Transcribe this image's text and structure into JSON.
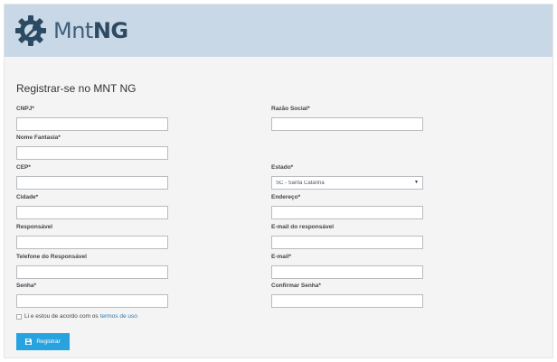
{
  "header": {
    "logo_text_light": "Mnt",
    "logo_text_bold": "NG"
  },
  "form": {
    "title": "Registrar-se no MNT NG",
    "cnpj": {
      "label": "CNPJ*",
      "value": ""
    },
    "razao_social": {
      "label": "Razão Social*",
      "value": ""
    },
    "nome_fantasia": {
      "label": "Nome Fantasia*",
      "value": ""
    },
    "cep": {
      "label": "CEP*",
      "value": ""
    },
    "estado": {
      "label": "Estado*",
      "selected": "SC - Santa Catarina"
    },
    "cidade": {
      "label": "Cidade*",
      "value": ""
    },
    "endereco": {
      "label": "Endereço*",
      "value": ""
    },
    "responsavel": {
      "label": "Responsável",
      "value": ""
    },
    "email_responsavel": {
      "label": "E-mail do responsável",
      "value": ""
    },
    "telefone_responsavel": {
      "label": "Telefone do Responsável",
      "value": ""
    },
    "email": {
      "label": "E-mail*",
      "value": ""
    },
    "senha": {
      "label": "Senha*",
      "value": ""
    },
    "confirmar_senha": {
      "label": "Confirmar Senha*",
      "value": ""
    },
    "terms_text": "Li e estou de acordo com os",
    "terms_link": "termos de uso",
    "register_label": "Registrar"
  },
  "colors": {
    "header_bg": "#c9d8e6",
    "logo": "#2d4a63",
    "button": "#29a3e0",
    "link": "#2a7ab0"
  },
  "icons": {
    "logo": "gear-wrench-icon",
    "register": "save-icon"
  }
}
